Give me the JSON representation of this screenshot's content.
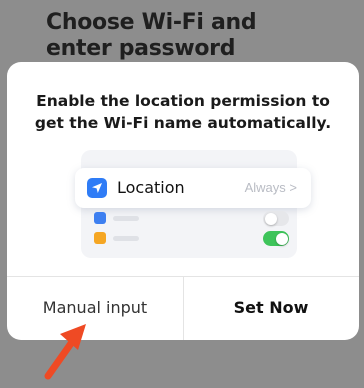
{
  "background": {
    "title_line1": "Choose Wi-Fi and",
    "title_line2": "enter password"
  },
  "dialog": {
    "message_line1": "Enable the location permission to",
    "message_line2": "get the Wi-Fi name automatically.",
    "illustration": {
      "location_label": "Location",
      "location_value": "Always >",
      "location_icon": "location-arrow-icon",
      "accent_color": "#2f7cf6",
      "toggle_on_color": "#3ec45a"
    },
    "buttons": {
      "manual_label": "Manual input",
      "set_now_label": "Set Now"
    }
  },
  "annotation": {
    "arrow_color": "#ef4a24",
    "arrow_icon": "pointer-arrow-icon"
  }
}
